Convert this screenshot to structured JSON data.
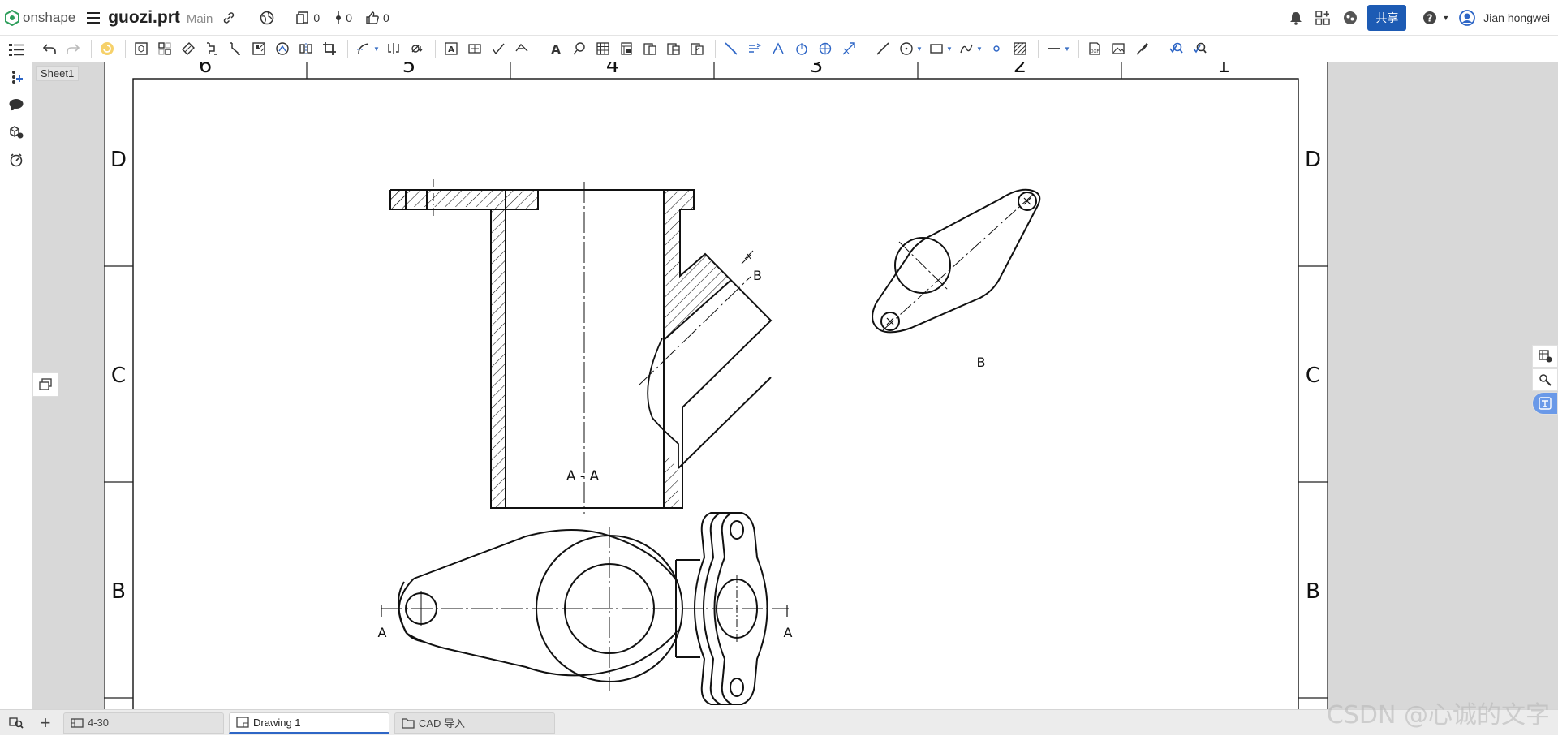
{
  "header": {
    "logo_text": "onshape",
    "doc_title": "guozi.prt",
    "branch": "Main",
    "versions_count": "0",
    "branches_count": "0",
    "likes_count": "0",
    "share_label": "共享",
    "user_name": "Jian hongwei"
  },
  "sheet": {
    "tab_label": "Sheet1",
    "zone_columns": [
      "6",
      "5",
      "4",
      "3",
      "2",
      "1"
    ],
    "zone_rows": [
      "D",
      "C",
      "B"
    ],
    "section_label": "A - A",
    "view_b_label": "B",
    "section_arrow_b": "B",
    "cut_label_left": "A",
    "cut_label_right": "A"
  },
  "tabs": [
    {
      "label": "4-30",
      "icon": "part-studio-icon"
    },
    {
      "label": "Drawing 1",
      "icon": "drawing-icon",
      "active": true
    },
    {
      "label": "CAD 导入",
      "icon": "folder-icon"
    }
  ],
  "watermark": "CSDN @心诚的文字",
  "colors": {
    "share_button": "#1d5bb4",
    "active_tab_underline": "#2e66c6",
    "logo_green": "#2e9e5b",
    "canvas_bg": "#d8d8d8"
  }
}
